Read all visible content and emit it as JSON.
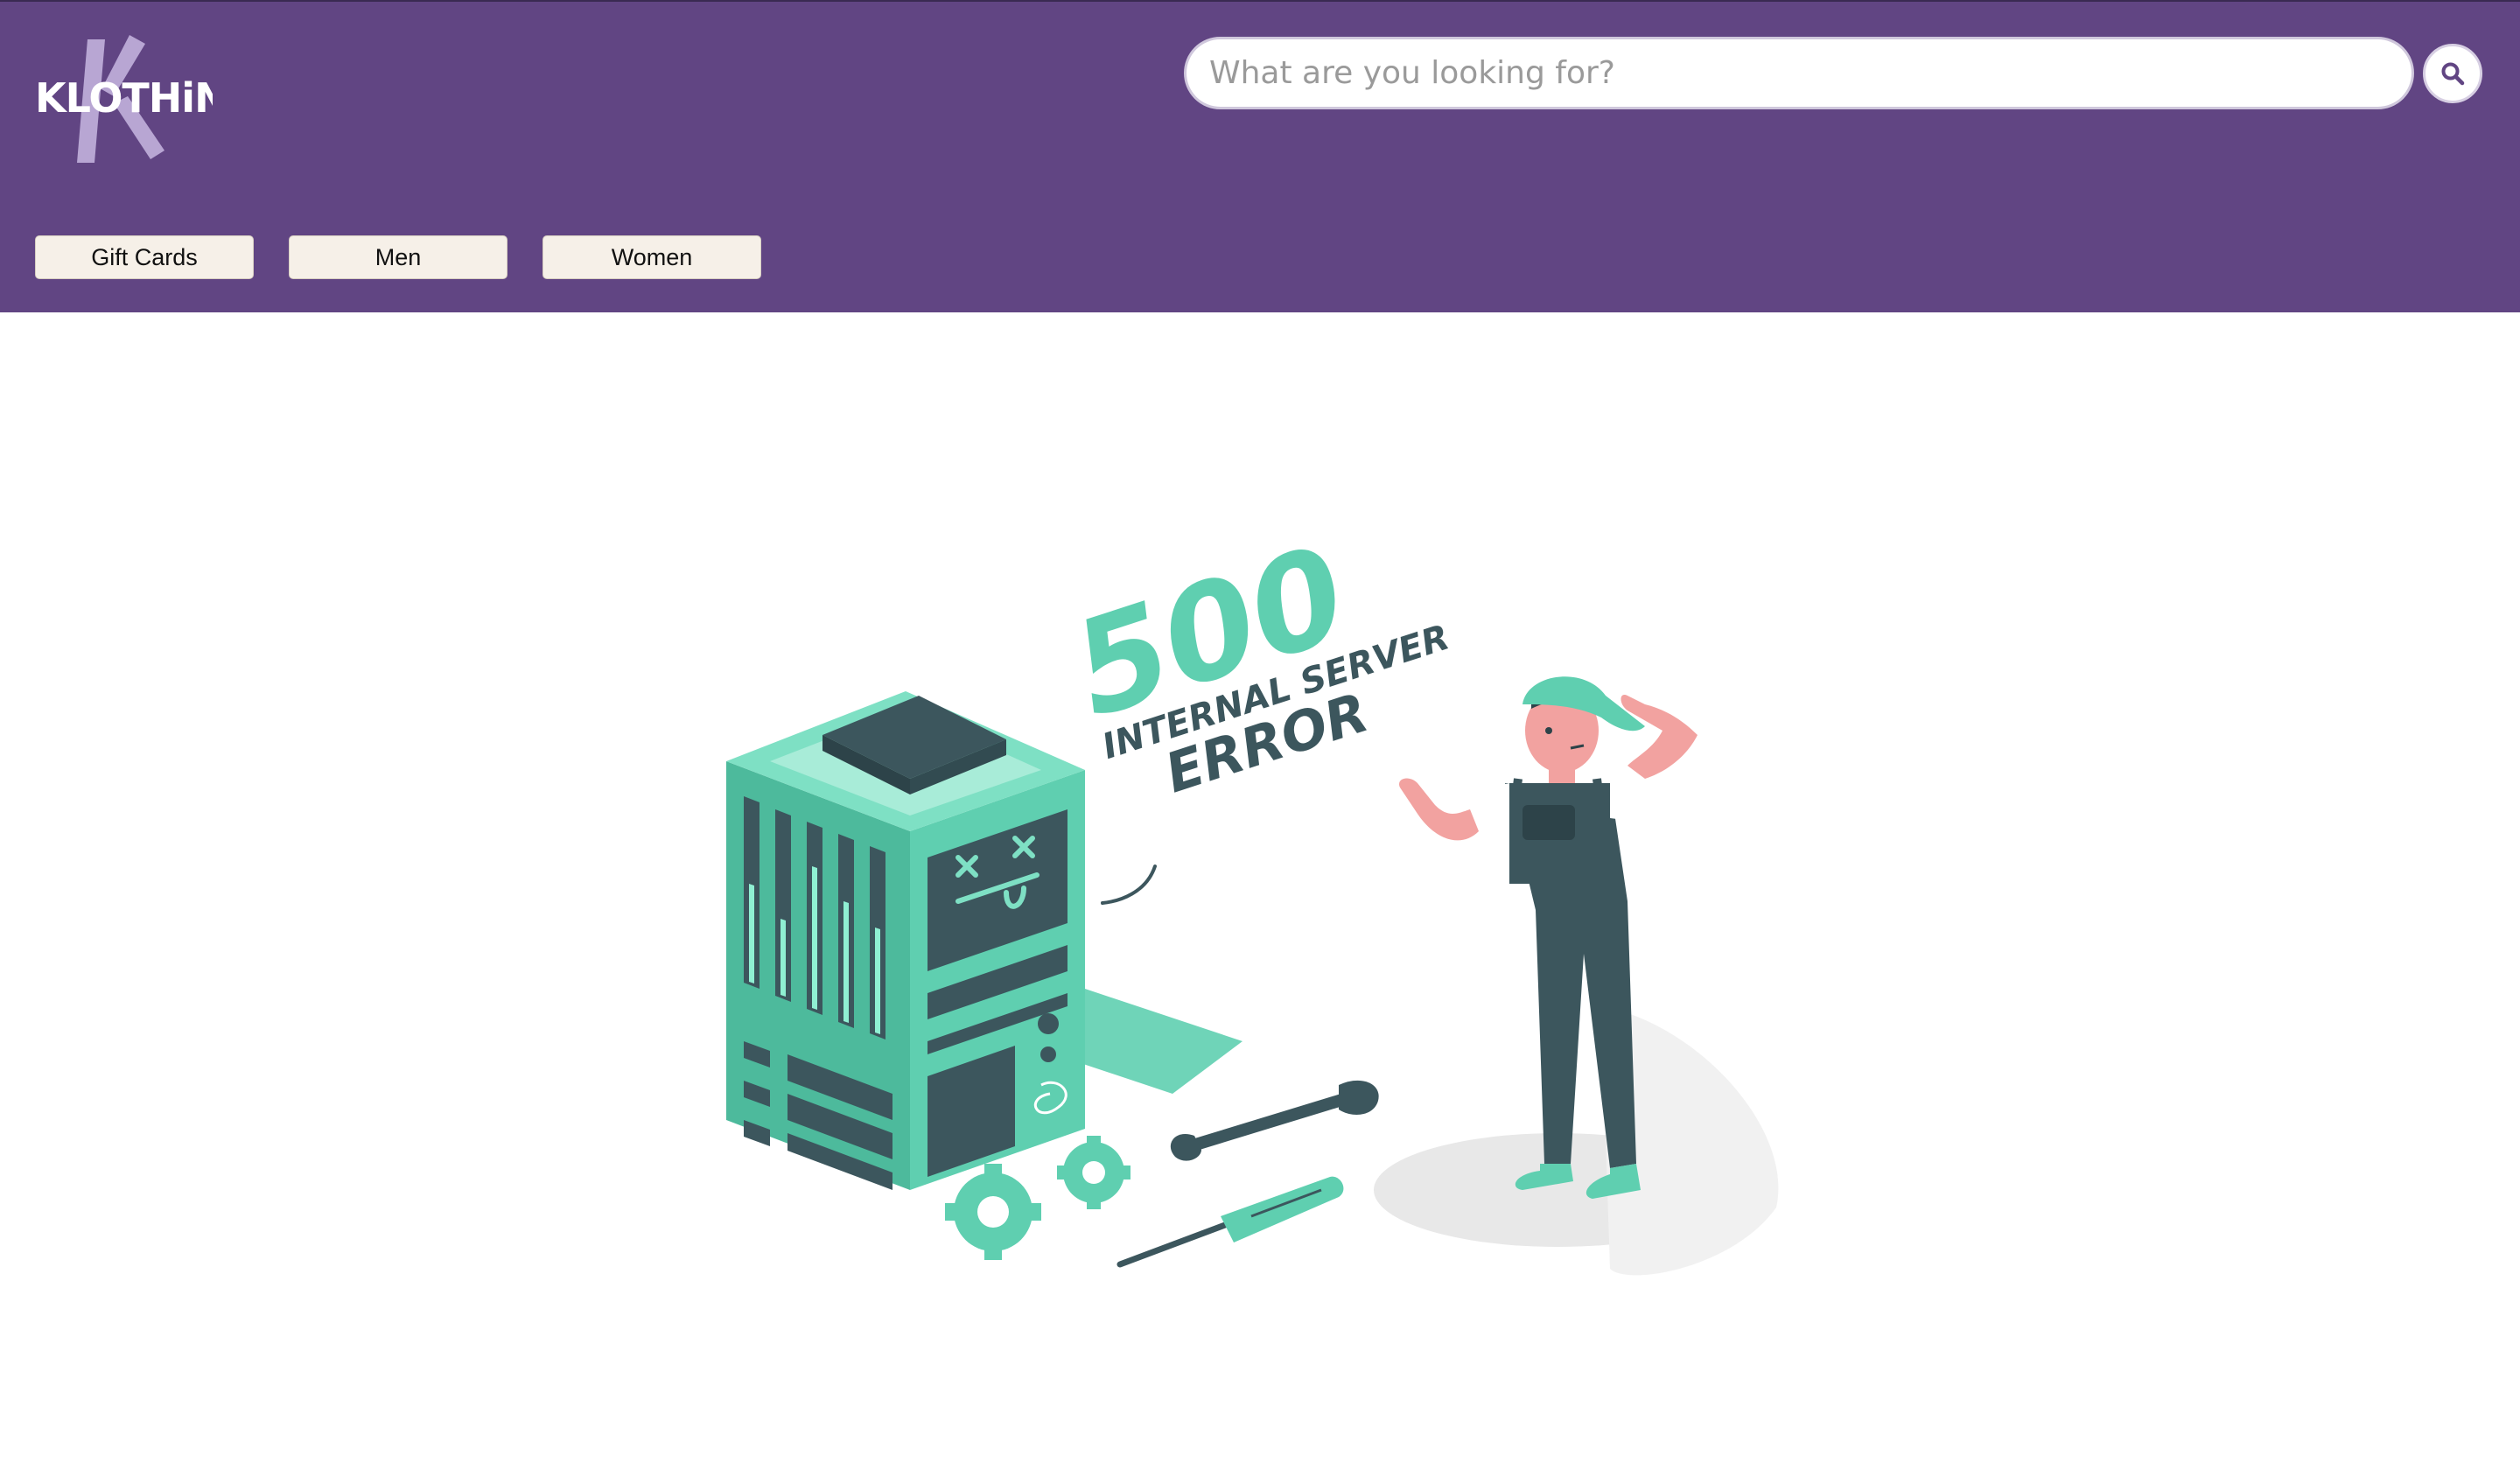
{
  "brand": {
    "logo_text": "KLOTHiNG"
  },
  "search": {
    "placeholder": "What are you looking for?",
    "value": ""
  },
  "nav": {
    "items": [
      {
        "label": "Gift Cards"
      },
      {
        "label": "Men"
      },
      {
        "label": "Women"
      }
    ]
  },
  "error": {
    "code": "500",
    "line1": "INTERNAL SERVER",
    "line2": "ERROR"
  },
  "colors": {
    "header_bg": "#614583",
    "nav_button_bg": "#f6f0e8",
    "illustration_primary": "#5fcfb0",
    "illustration_dark": "#3c565d"
  },
  "icons": {
    "search": "search-icon"
  }
}
